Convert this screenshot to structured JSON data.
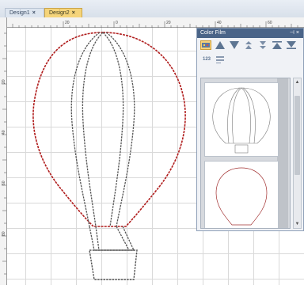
{
  "tabs": [
    {
      "label": "Design1",
      "close": "×",
      "active": false
    },
    {
      "label": "Design2",
      "close": "×",
      "active": true
    }
  ],
  "ruler": {
    "top_labels": [
      "20",
      "0",
      "20",
      "40",
      "60"
    ],
    "left_labels": [
      "20",
      "40",
      "60",
      "80"
    ]
  },
  "panel": {
    "title": "Color Film",
    "pin_glyph": "⊣",
    "close_glyph": "×",
    "toolbar_text": "123"
  },
  "colors": {
    "thread_red": "#b01c1c",
    "thread_gray": "#555555",
    "active_tab": "#f5d47a",
    "panel_title": "#4a6488"
  },
  "icons": [
    "film-mode-icon",
    "move-up-icon",
    "move-down-icon",
    "move-up-step-icon",
    "move-down-step-icon",
    "move-top-icon",
    "move-bottom-icon",
    "number-sort-icon",
    "list-icon"
  ]
}
